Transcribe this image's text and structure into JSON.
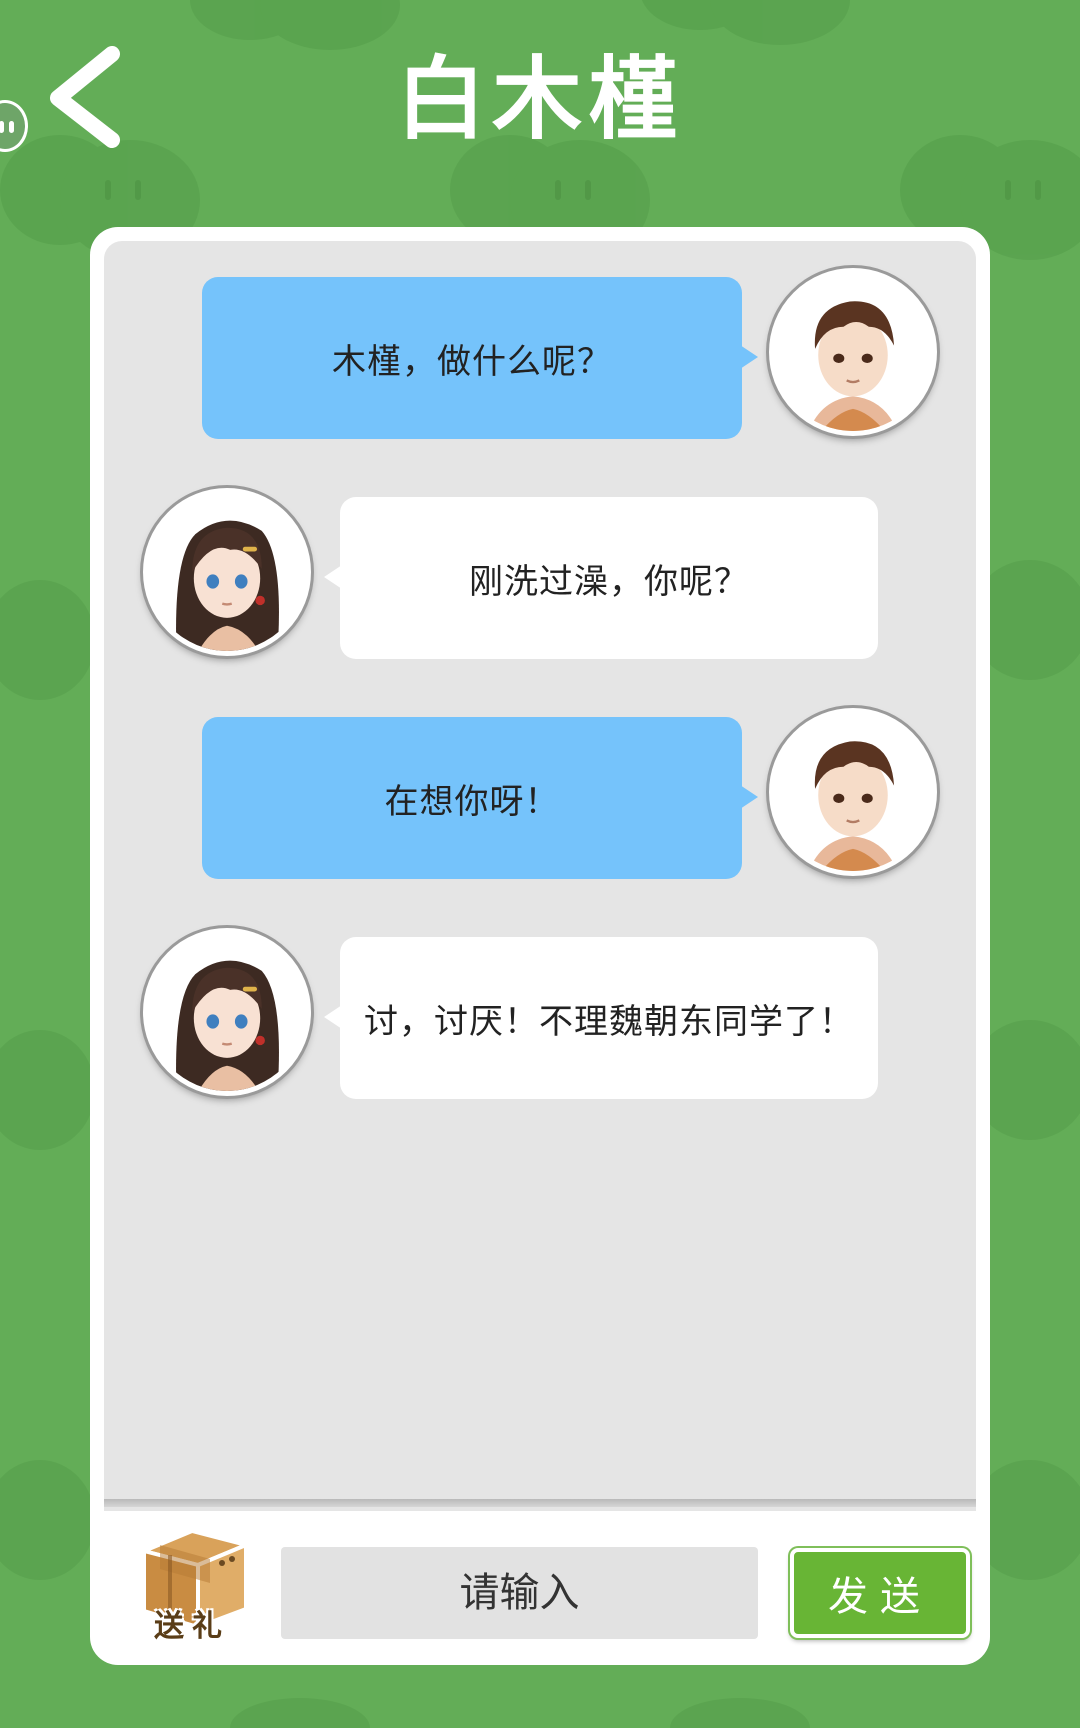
{
  "header": {
    "title": "白木槿",
    "back_icon": "chevron-left-icon"
  },
  "messages": [
    {
      "side": "right",
      "sender": "boy",
      "text": "木槿，做什么呢？"
    },
    {
      "side": "left",
      "sender": "girl",
      "text": "刚洗过澡，你呢？"
    },
    {
      "side": "right",
      "sender": "boy",
      "text": "在想你呀！"
    },
    {
      "side": "left",
      "sender": "girl",
      "text": "讨，讨厌！不理魏朝东同学了！"
    }
  ],
  "input_bar": {
    "gift_label": "送礼",
    "gift_icon": "cardboard-box-icon",
    "placeholder": "请输入",
    "value": "",
    "send_label": "发送"
  },
  "colors": {
    "background": "#63ad57",
    "outgoing_bubble": "#75c3fb",
    "incoming_bubble": "#ffffff",
    "send_button": "#68b535",
    "chat_area": "#e5e5e5"
  }
}
